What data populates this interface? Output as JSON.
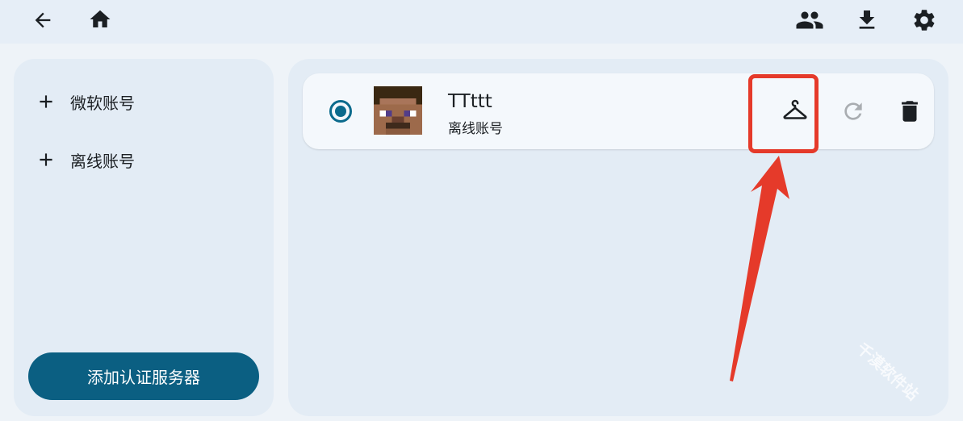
{
  "topbar": {
    "back_icon": "arrow-left-icon",
    "home_icon": "home-icon",
    "accounts_icon": "people-icon",
    "download_icon": "download-icon",
    "settings_icon": "gear-icon"
  },
  "sidebar": {
    "items": [
      {
        "label": "微软账号",
        "icon": "plus-icon"
      },
      {
        "label": "离线账号",
        "icon": "plus-icon"
      }
    ],
    "add_server_label": "添加认证服务器"
  },
  "accounts": [
    {
      "name": "TTttt",
      "type": "离线账号",
      "selected": true,
      "actions": [
        "hanger-icon",
        "refresh-icon",
        "trash-icon"
      ]
    }
  ],
  "watermark": "千漠软件站",
  "colors": {
    "accent": "#0b5f82",
    "radio": "#0b6a8c",
    "annotation": "#e53a2a",
    "background": "#eef3f8",
    "panel": "#e3ecf5"
  }
}
